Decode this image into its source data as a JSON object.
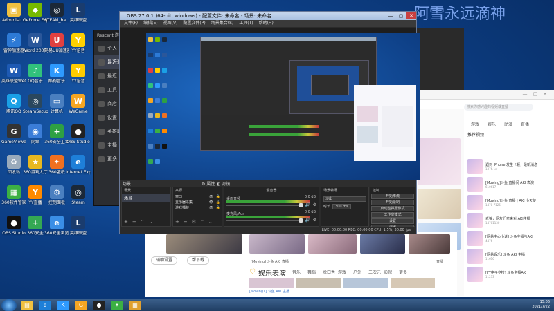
{
  "watermark": "阿雪永远滴神",
  "desktop_icons": [
    {
      "label": "Administr...",
      "icon": "user-folder-icon",
      "color": "#f0c040",
      "glyph": "▣"
    },
    {
      "label": "GeForce Experience",
      "icon": "nvidia-icon",
      "color": "#76b900",
      "glyph": "◆"
    },
    {
      "label": "STEAM_ba...",
      "icon": "steam-icon",
      "color": "#1b2838",
      "glyph": "◎"
    },
    {
      "label": "英雄联盟",
      "icon": "league-icon",
      "color": "#1a3c6e",
      "glyph": "L"
    },
    {
      "label": "雷神加速器",
      "icon": "accelerator-icon",
      "color": "#2d7ad6",
      "glyph": "⚡"
    },
    {
      "label": "Word 2007",
      "icon": "word-icon",
      "color": "#2b579a",
      "glyph": "W"
    },
    {
      "label": "网易UU加速器",
      "icon": "uu-icon",
      "color": "#e04040",
      "glyph": "U"
    },
    {
      "label": "YY语音",
      "icon": "yy-icon",
      "color": "#ffd100",
      "glyph": "Y"
    },
    {
      "label": "英雄联盟WeGame",
      "icon": "wegame-icon",
      "color": "#1e5ab4",
      "glyph": "W"
    },
    {
      "label": "QQ音乐",
      "icon": "qq-music-icon",
      "color": "#31c27c",
      "glyph": "♪"
    },
    {
      "label": "酷狗音乐",
      "icon": "kugou-icon",
      "color": "#2e9afe",
      "glyph": "K"
    },
    {
      "label": "YY语音",
      "icon": "yy-icon",
      "color": "#ffcc00",
      "glyph": "Y"
    },
    {
      "label": "腾讯QQ",
      "icon": "qq-icon",
      "color": "#1aa0e6",
      "glyph": "Q"
    },
    {
      "label": "SteamSetup",
      "icon": "steam-icon",
      "color": "#2a475e",
      "glyph": "◎"
    },
    {
      "label": "计算机",
      "icon": "computer-icon",
      "color": "#4a7fc0",
      "glyph": "▭"
    },
    {
      "label": "WeGame",
      "icon": "wegame-icon",
      "color": "#f5a623",
      "glyph": "W"
    },
    {
      "label": "GameViewer",
      "icon": "game-icon",
      "color": "#333",
      "glyph": "G"
    },
    {
      "label": "网络",
      "icon": "network-icon",
      "color": "#3b7dd8",
      "glyph": "◉"
    },
    {
      "label": "360安全卫士",
      "icon": "360-icon",
      "color": "#2ea043",
      "glyph": "+"
    },
    {
      "label": "OBS Studio",
      "icon": "obs-icon",
      "color": "#222",
      "glyph": "●"
    },
    {
      "label": "回收站",
      "icon": "recycle-bin-icon",
      "color": "#9ab",
      "glyph": "♻"
    },
    {
      "label": "360游戏大厅",
      "icon": "360-game-icon",
      "color": "#e8b820",
      "glyph": "★"
    },
    {
      "label": "360壁纸",
      "icon": "wallpaper-icon",
      "color": "#f07020",
      "glyph": "✦"
    },
    {
      "label": "Internet Explorer",
      "icon": "ie-icon",
      "color": "#1e7fd8",
      "glyph": "e"
    },
    {
      "label": "360软件管家",
      "icon": "software-icon",
      "color": "#3cb043",
      "glyph": "▦"
    },
    {
      "label": "YY直播",
      "icon": "yy-live-icon",
      "color": "#ff8a00",
      "glyph": "Y"
    },
    {
      "label": "控制面板",
      "icon": "control-panel-icon",
      "color": "#4a7fc0",
      "glyph": "⚙"
    },
    {
      "label": "Steam",
      "icon": "steam-icon",
      "color": "#1b2838",
      "glyph": "◎"
    },
    {
      "label": "OBS Studio",
      "icon": "obs-icon",
      "color": "#111",
      "glyph": "●"
    },
    {
      "label": "360安全",
      "icon": "360-icon",
      "color": "#34a853",
      "glyph": "+"
    },
    {
      "label": "360安全浏览器",
      "icon": "browser-icon",
      "color": "#3a8ee6",
      "glyph": "e"
    },
    {
      "label": "英雄联盟",
      "icon": "league-icon",
      "color": "#1a3c6e",
      "glyph": "L"
    }
  ],
  "obs": {
    "title": "OBS 27.0.1 (64-bit, windows) - 配置文件: 未命名 - 场景: 未命名",
    "menu": [
      "文件(F)",
      "编辑(E)",
      "视图(V)",
      "配置文件(P)",
      "场景集合(S)",
      "工具(T)",
      "帮助(H)"
    ],
    "docks": {
      "scenes": "场景",
      "sources": "来源",
      "mixer": "混音器",
      "transitions": "场景转场",
      "controls": "控制"
    },
    "scene_item": "场景",
    "sources": [
      "窗口",
      "显示器采集",
      "游戏捕获"
    ],
    "mixer": [
      {
        "label": "桌面音频",
        "db": "0.0 dB"
      },
      {
        "label": "麦克风/Aux",
        "db": "0.0 dB"
      }
    ],
    "transition": {
      "type": "淡出",
      "duration_label": "时长",
      "duration": "300 ms"
    },
    "controls": [
      "开始推流",
      "开始录制",
      "启动虚拟摄像机",
      "工作室模式",
      "设置",
      "退出"
    ],
    "status": "LIVE: 00:00:00   REC: 00:00:00   CPU: 1.5%, 30.00 fps",
    "properties_label": "属性",
    "filters_label": "滤镜"
  },
  "back_app": {
    "title": "Rescent 游戏",
    "rows": [
      "个人",
      "最近游戏",
      "最近",
      "工具",
      "商店",
      "设置",
      "英雄联盟",
      "主播",
      "更多"
    ]
  },
  "browser_right": {
    "search_placeholder": "搜索你感兴趣的视频或直播",
    "section": "推荐视频",
    "nav": [
      "游戏",
      "娱乐",
      "动漫",
      "直播"
    ],
    "feed": [
      {
        "title": "遇到 iPhone 发生卡顿，最新消息",
        "sub": "1376.1w"
      },
      {
        "title": "[Moving]斗鱼 直播间 AKI 表演",
        "sub": "610617"
      },
      {
        "title": "[Moving]斗鱼 直播 | AKI 小天使",
        "sub": "1470-7126"
      },
      {
        "title": "老狼，网友们拿来对 AKI主播",
        "sub": "14701130"
      },
      {
        "title": "[网易中心小说] 斗鱼主播与AKI",
        "sub": "4476"
      },
      {
        "title": "[网易娱乐] 斗鱼 AKI 主播",
        "sub": "11616"
      },
      {
        "title": "[FT电子竞技] 斗鱼主播AKI",
        "sub": "11233"
      }
    ]
  },
  "lower_window": {
    "btn_left": "辅助设置",
    "btn_right": "帮下载",
    "section_title": "娱乐表演",
    "tabs": [
      "音乐",
      "舞蹈",
      "脱口秀",
      "游戏",
      "户外",
      "二次元",
      "影视",
      "更多"
    ],
    "caption1": "[Moving] 斗鱼 AKI 直播",
    "caption2": "直播",
    "footer": "[Moving1] 斗鱼 AKI 主播"
  },
  "taskbar": {
    "time": "15:06",
    "date": "2021/7/22",
    "apps": [
      {
        "icon": "explorer-icon",
        "color": "#f0c040",
        "glyph": "▤"
      },
      {
        "icon": "ie-icon",
        "color": "#1e7fd8",
        "glyph": "e"
      },
      {
        "icon": "kugou-icon",
        "color": "#2e9afe",
        "glyph": "K"
      },
      {
        "icon": "wegame-icon",
        "color": "#f5a623",
        "glyph": "G"
      },
      {
        "icon": "obs-icon",
        "color": "#222",
        "glyph": "●"
      },
      {
        "icon": "360-icon",
        "color": "#3cb043",
        "glyph": "✦"
      },
      {
        "icon": "folder-icon",
        "color": "#e0a030",
        "glyph": "▦"
      }
    ]
  }
}
